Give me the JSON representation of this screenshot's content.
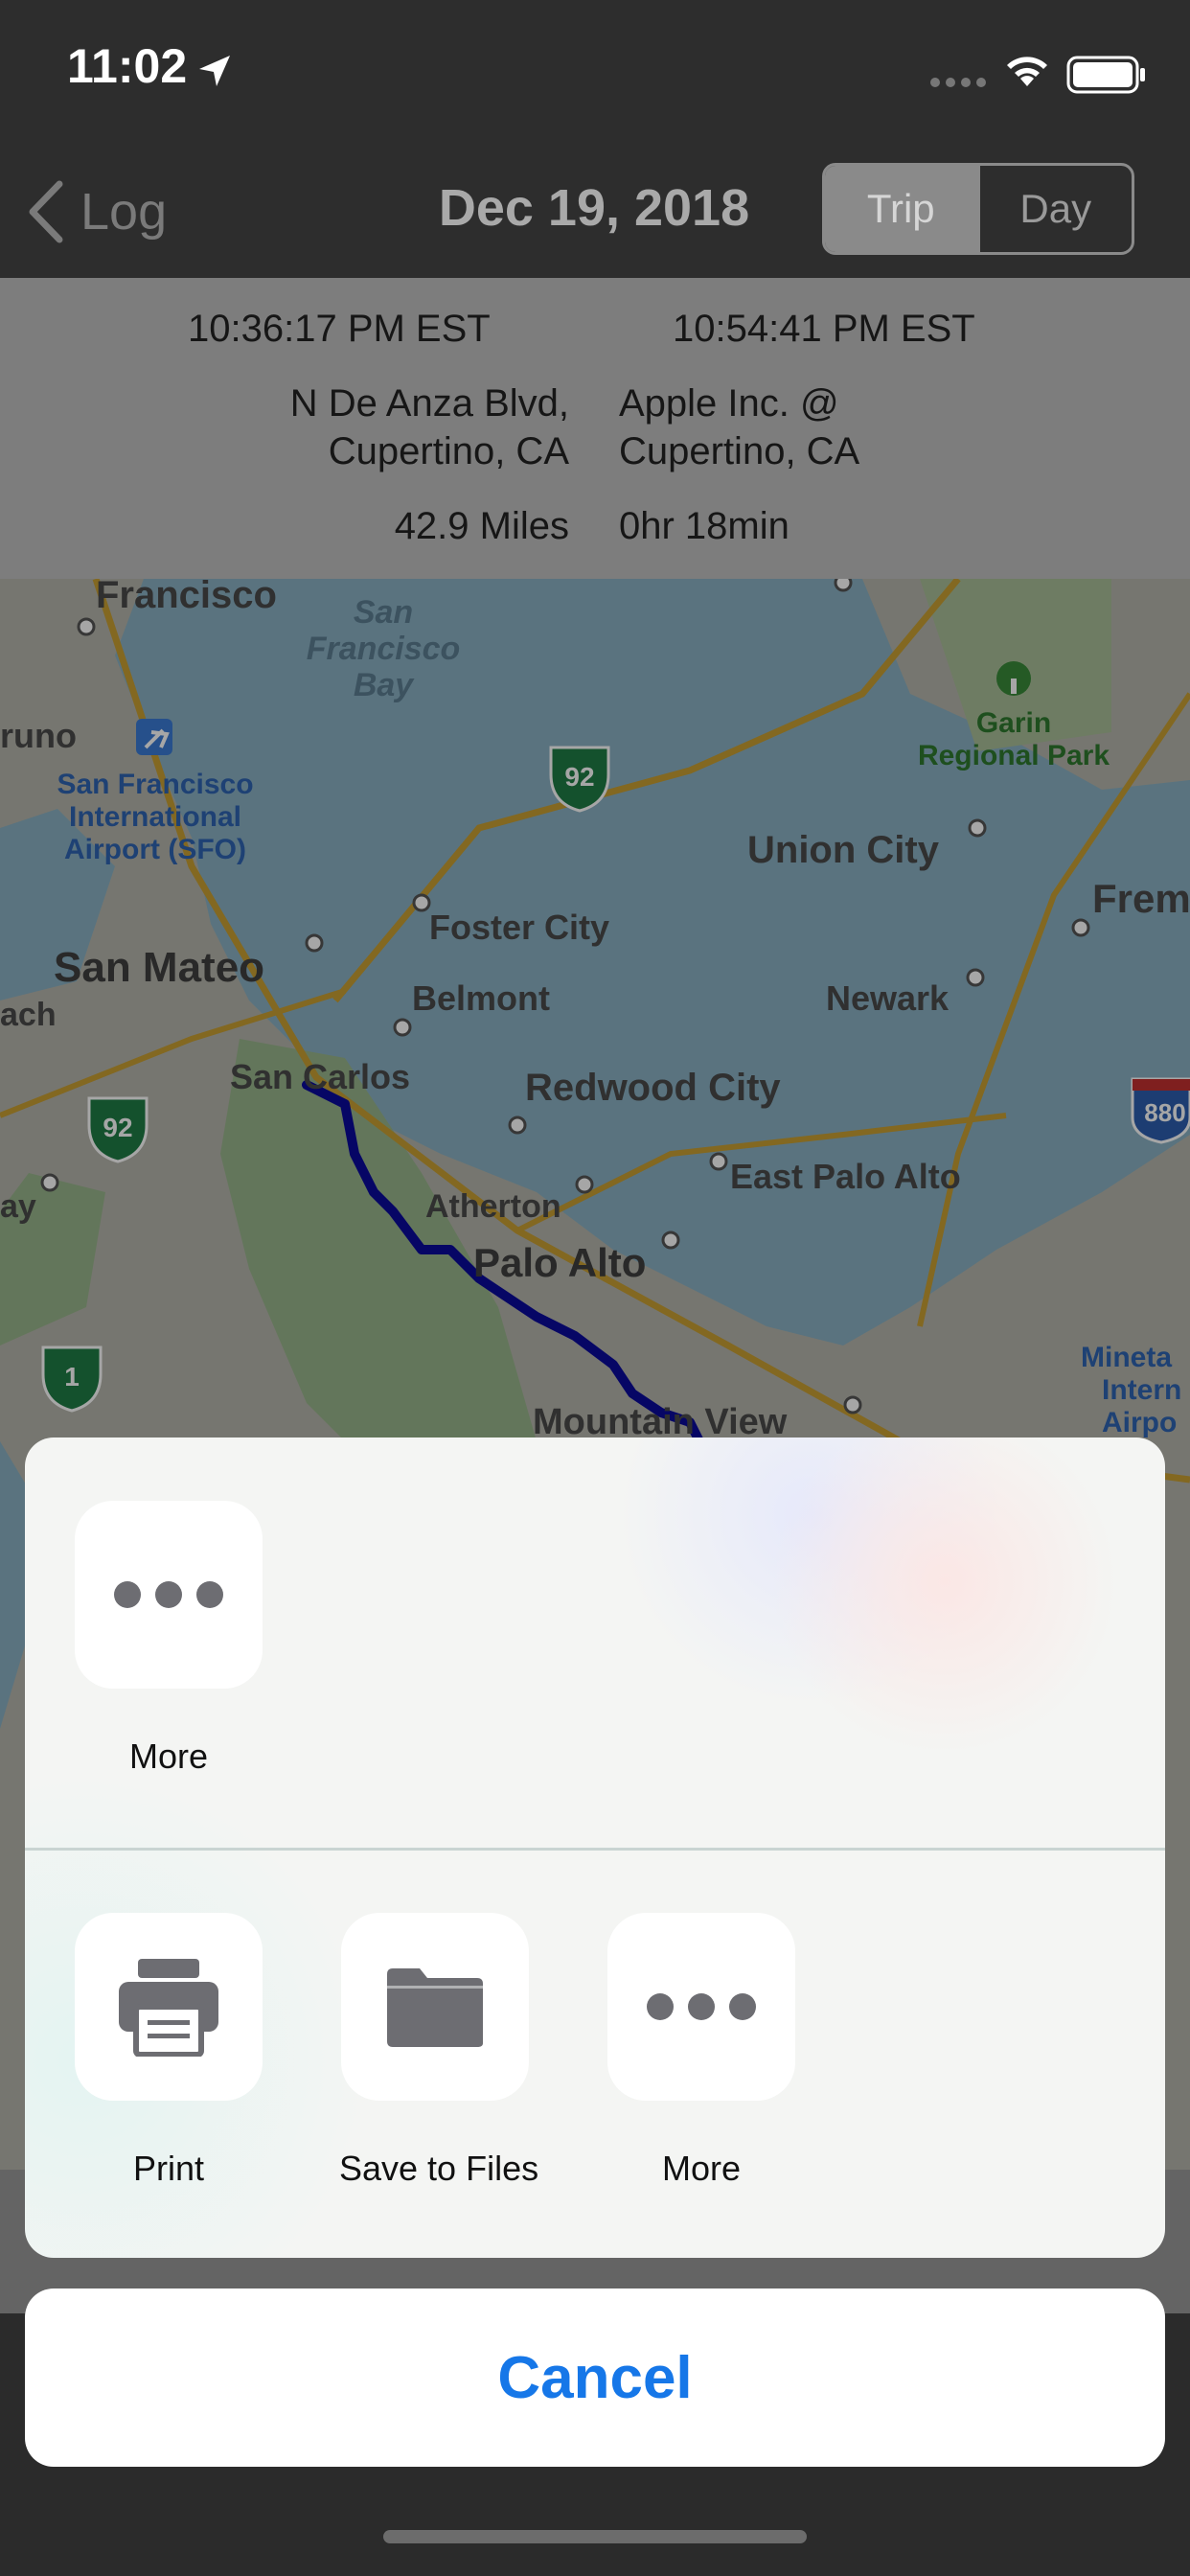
{
  "status_bar": {
    "time": "11:02"
  },
  "nav": {
    "back_label": "Log",
    "title": "Dec 19, 2018",
    "segments": [
      {
        "label": "Trip",
        "active": true
      },
      {
        "label": "Day",
        "active": false
      }
    ]
  },
  "trip": {
    "start_time": "10:36:17 PM EST",
    "end_time": "10:54:41 PM EST",
    "start_address_line1": "N De Anza Blvd,",
    "start_address_line2": "Cupertino, CA",
    "end_address_line1": "Apple Inc. @",
    "end_address_line2": "Cupertino, CA",
    "distance": "42.9 Miles",
    "duration": "0hr 18min"
  },
  "map": {
    "labels": {
      "francisco": "Francisco",
      "sf_bay": [
        "San",
        "Francisco",
        "Bay"
      ],
      "uno": "runo",
      "sfo": [
        "San Francisco",
        "International",
        "Airport (SFO)"
      ],
      "garin": [
        "Garin",
        "Regional Park"
      ],
      "union_city": "Union City",
      "fremont": "Frem",
      "foster_city": "Foster City",
      "san_mateo": "San Mateo",
      "belmont": "Belmont",
      "newark": "Newark",
      "ach": "ach",
      "san_carlos": "San Carlos",
      "redwood_city": "Redwood City",
      "east_palo_alto": "East Palo Alto",
      "ay": "ay",
      "atherton": "Atherton",
      "palo_alto": "Palo Alto",
      "mineta": [
        "Mineta",
        "Intern",
        "Airpo"
      ],
      "mountain_view": "Mountain View"
    },
    "shields": {
      "hwy_92_a": "92",
      "hwy_92_b": "92",
      "hwy_1": "1",
      "i_880": "880"
    },
    "colors": {
      "water": "#8ab1c4",
      "land": "#b6b6ac",
      "park": "#99b58c",
      "route": "#0a0a9c",
      "road": "#c9a033"
    }
  },
  "share_sheet": {
    "row1": [
      {
        "label": "More",
        "icon": "ellipsis-icon"
      }
    ],
    "row2": [
      {
        "label": "Print",
        "icon": "printer-icon"
      },
      {
        "label": "Save to Files",
        "icon": "folder-icon"
      },
      {
        "label": "More",
        "icon": "ellipsis-icon"
      }
    ],
    "cancel_label": "Cancel"
  }
}
